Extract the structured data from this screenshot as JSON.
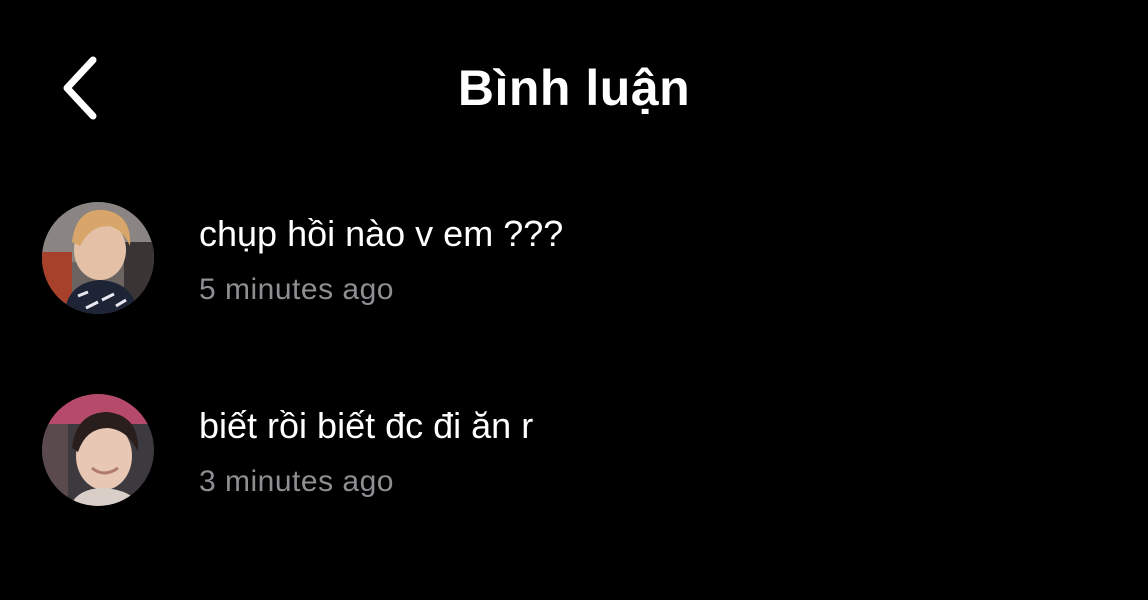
{
  "header": {
    "title": "Bình luận",
    "back_icon": "chevron-left-icon"
  },
  "comments": [
    {
      "text": "chụp hồi nào v em ???",
      "time": "5 minutes ago",
      "avatar": "user-avatar-photo"
    },
    {
      "text": "biết rồi biết đc đi ăn r",
      "time": "3 minutes ago",
      "avatar": "user-avatar-photo"
    }
  ],
  "colors": {
    "background": "#000000",
    "text": "#ffffff",
    "secondary_text": "#8e8e93"
  }
}
